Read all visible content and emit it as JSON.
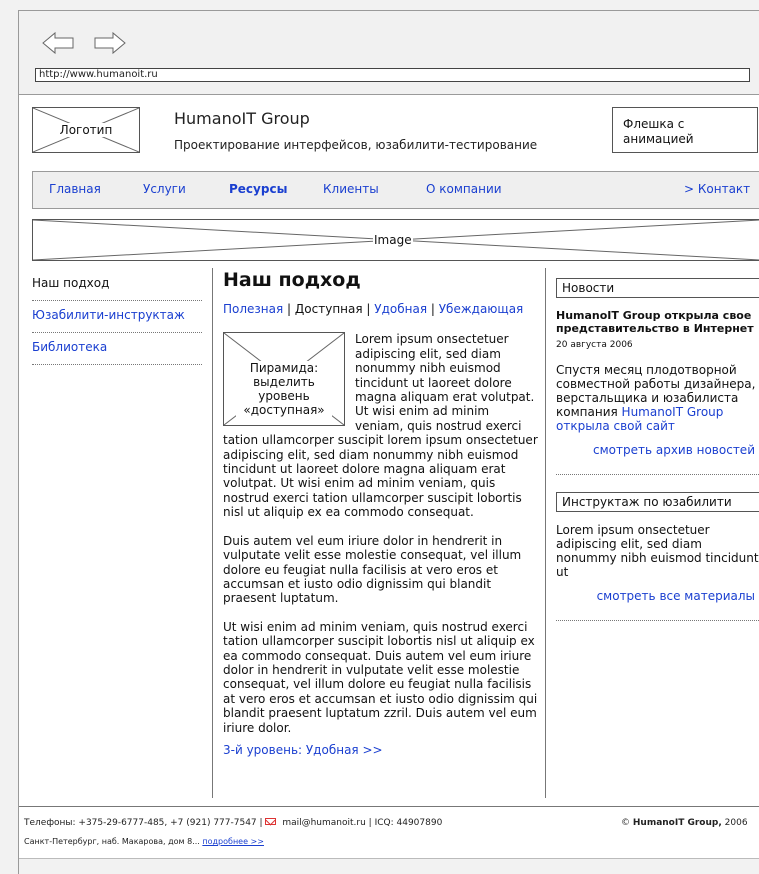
{
  "browser": {
    "url": "http://www.humanoit.ru"
  },
  "header": {
    "logo_label": "Логотип",
    "title": "HumanoIT Group",
    "subtitle": "Проектирование интерфейсов, юзабилити-тестирование",
    "flash_label": "Флешка с анимацией"
  },
  "menu": {
    "items": [
      "Главная",
      "Услуги",
      "Ресурсы",
      "Клиенты",
      "О компании"
    ],
    "contact": "> Контакт",
    "active": "Ресурсы"
  },
  "banner": {
    "label": "Image"
  },
  "leftnav": {
    "items": [
      "Наш подход",
      "Юзабилити-инструктаж",
      "Библиотека"
    ]
  },
  "main": {
    "title": "Наш подход",
    "levels": [
      "Полезная",
      "Доступная",
      "Удобная",
      "Убеждающая"
    ],
    "pyramid_label": "Пирамида: выделить уровень «доступная»",
    "p1": "Lorem ipsum onsectetuer adipiscing elit, sed diam nonummy nibh euismod tincidunt ut laoreet dolore magna aliquam erat volutpat. Ut wisi enim ad minim veniam, quis nostrud exerci tation ullamcorper suscipit lorem ipsum onsectetuer adipiscing elit, sed diam nonummy nibh euismod tincidunt ut laoreet dolore magna aliquam erat volutpat. Ut wisi enim ad minim veniam, quis nostrud exerci tation ullamcorper suscipit lobortis nisl ut aliquip ex ea commodo consequat.",
    "p2": "Duis autem vel eum iriure dolor in hendrerit in vulputate velit esse molestie consequat, vel illum dolore eu feugiat nulla facilisis at vero eros et accumsan et iusto odio dignissim qui blandit praesent luptatum.",
    "p3": "Ut wisi enim ad minim veniam, quis nostrud exerci tation ullamcorper suscipit lobortis nisl ut aliquip ex ea commodo consequat. Duis autem vel eum iriure dolor in hendrerit in vulputate velit esse molestie consequat, vel illum dolore eu feugiat nulla facilisis at vero eros et accumsan et iusto odio dignissim qui blandit praesent luptatum zzril. Duis autem vel eum iriure dolor.",
    "next_link": "3-й уровень: Удобная >>"
  },
  "news": {
    "heading": "Новости",
    "title": "HumanoIT Group открыла свое представительство в Интернет",
    "date": "20 августа 2006",
    "body": "Спустя месяц плодотворной совместной работы дизайнера, верстальщика и юзабилиста компания",
    "body_link": "HumanoIT Group открыла свой сайт",
    "archive": "смотреть архив новостей"
  },
  "instr": {
    "heading": "Инструктаж по юзабилити",
    "body": "Lorem ipsum onsectetuer adipiscing elit, sed diam nonummy nibh euismod tincidunt ut",
    "all": "смотреть все материалы"
  },
  "footer": {
    "phones": "Телефоны: +375-29-6777-485, +7 (921) 777-7547",
    "email": "mail@humanoit.ru",
    "icq": "ICQ: 44907890",
    "copy_brand": "HumanoIT Group,",
    "copy_year": "2006",
    "address": "Санкт-Петербург, наб. Макарова, дом 8...",
    "more": "подробнее >>"
  }
}
